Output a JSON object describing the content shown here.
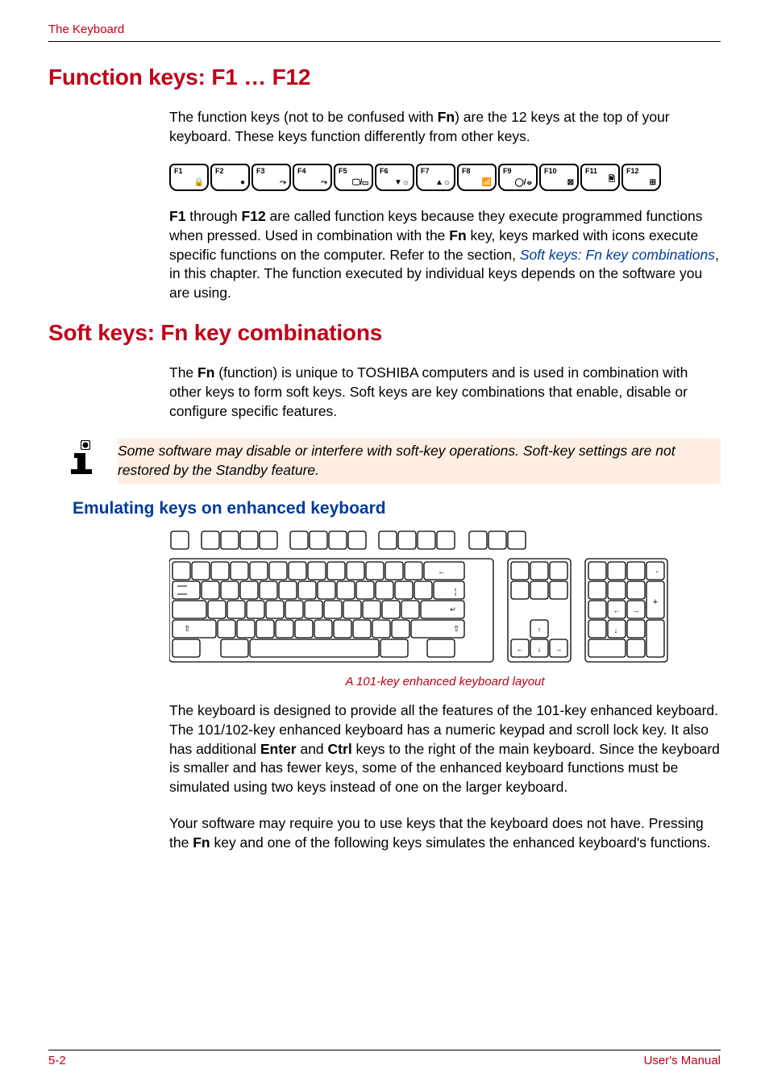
{
  "header": "The Keyboard",
  "h1_1": "Function keys: F1 … F12",
  "p1_a": "The function keys (not to be confused with ",
  "p1_b": "Fn",
  "p1_c": ") are the 12 keys at the top of your keyboard. These keys function differently from other keys.",
  "fkeys": [
    "F1",
    "F2",
    "F3",
    "F4",
    "F5",
    "F6",
    "F7",
    "F8",
    "F9",
    "F10",
    "F11",
    "F12"
  ],
  "fglyphs": [
    "🔒",
    "●",
    "⤳",
    "⤳",
    "🖵/▭",
    "▼☼",
    "▲☼",
    "📶",
    "◯/⦵",
    "⊠",
    "🖹",
    "⊞"
  ],
  "p2_a": "F1",
  "p2_b": " through ",
  "p2_c": "F12",
  "p2_d": " are called function keys because they execute programmed functions when pressed. Used in combination with the ",
  "p2_e": "Fn",
  "p2_f": " key, keys marked with icons execute specific functions on the computer. Refer to the section, ",
  "p2_link": "Soft keys: Fn key combinations",
  "p2_g": ", in this chapter. The function executed by individual keys depends on the software you are using.",
  "h1_2": "Soft keys: Fn key combinations",
  "p3_a": "The ",
  "p3_b": "Fn",
  "p3_c": " (function) is unique to TOSHIBA computers and is used in combination with other keys to form soft keys. Soft keys are key combinations that enable, disable or configure specific features.",
  "note": "Some software may disable or interfere with soft-key operations. Soft-key settings are not restored by the Standby feature.",
  "h2_1": "Emulating keys on enhanced keyboard",
  "caption": "A 101-key enhanced keyboard layout",
  "p4_a": "The keyboard is designed to provide all the features of the 101-key enhanced keyboard. The 101/102-key enhanced keyboard has a numeric keypad and scroll lock key. It also has additional ",
  "p4_b": "Enter",
  "p4_c": " and ",
  "p4_d": "Ctrl",
  "p4_e": " keys to the right of the main keyboard. Since the keyboard is smaller and has fewer keys, some of the enhanced keyboard functions must be simulated using two keys instead of one on the larger keyboard.",
  "p5_a": "Your software may require you to use keys that the keyboard does not have. Pressing the ",
  "p5_b": "Fn",
  "p5_c": " key and one of the following keys simulates the enhanced keyboard's functions.",
  "footer_left": "5-2",
  "footer_right": "User's Manual"
}
